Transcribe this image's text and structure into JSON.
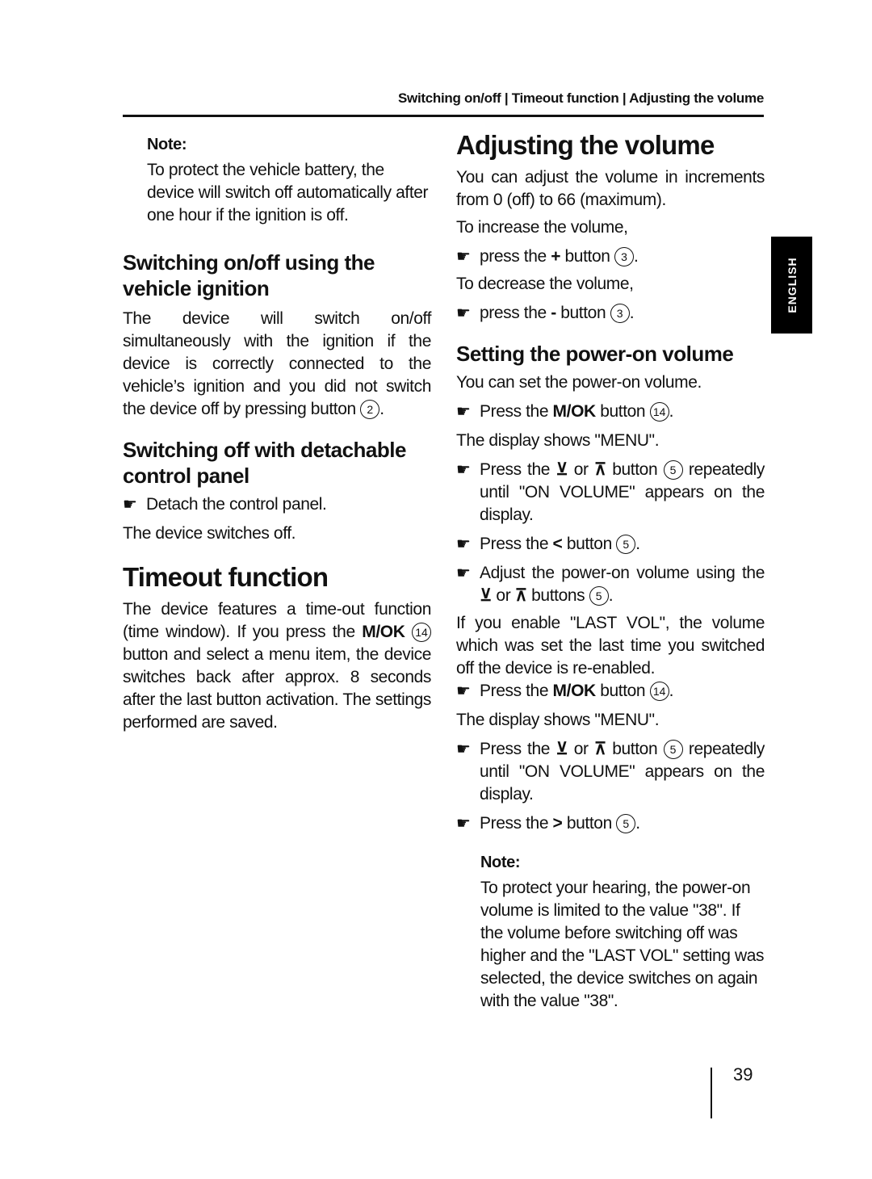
{
  "running_head": "Switching on/off | Timeout function | Adjusting the volume",
  "language_tab": "ENGLISH",
  "page_number": "39",
  "left": {
    "note1": {
      "label": "Note:",
      "text": "To protect the vehicle battery, the device will switch off automatically after one hour if the ignition is off."
    },
    "ignition": {
      "heading": "Switching on/off using the vehicle ignition",
      "text": "The device will switch on/off simultaneously with the ignition if the device is correctly connected to the vehicle’s ignition and you did not switch the device off by pressing button",
      "button_num": "2"
    },
    "detachable": {
      "heading": "Switching off with detachable control panel",
      "step": "Detach the control panel.",
      "result": "The device switches off."
    },
    "timeout": {
      "heading": "Timeout function",
      "text_a": "The device features a time-out function (time window). If you press the",
      "key": "M/OK",
      "button_num": "14",
      "text_b": "button and select a menu item, the device switches back after approx. 8 seconds after the last button activation. The settings performed are saved."
    }
  },
  "right": {
    "volume": {
      "heading": "Adjusting the volume",
      "intro": "You can adjust the volume in increments from 0 (off) to 66 (maximum).",
      "increase_intro": "To increase the volume,",
      "increase_step_a": "press the",
      "increase_key": "+",
      "increase_step_b": "button",
      "decrease_intro": "To decrease the volume,",
      "decrease_step_a": "press the",
      "decrease_key": "-",
      "decrease_step_b": "button",
      "button_num": "3"
    },
    "power_on": {
      "heading": "Setting the power-on volume",
      "intro": "You can set the power-on volume.",
      "steps": {
        "press_the": "Press the",
        "mok": "M/OK",
        "button": "button",
        "num14": "14",
        "num5": "5",
        "or": "or",
        "repeatedly": "repeatedly",
        "until": "until \"ON VOLUME\" appears on the display.",
        "display_menu": "The display shows \"MENU\".",
        "adjust": "Adjust the power-on volume using the",
        "buttons": "buttons",
        "down_glyph": "⊻",
        "up_glyph": "⊼",
        "left_glyph": "<",
        "right_glyph": ">"
      },
      "last_vol": "If you enable \"LAST VOL\", the volume which was set the last time you switched off the device is re-enabled."
    },
    "note2": {
      "label": "Note:",
      "text": "To protect your hearing, the power-on volume is limited to the value \"38\". If the volume before switching off was higher and the \"LAST VOL\" setting was selected, the device switches on again with the value \"38\"."
    }
  },
  "icons": {
    "hand": "☛"
  }
}
